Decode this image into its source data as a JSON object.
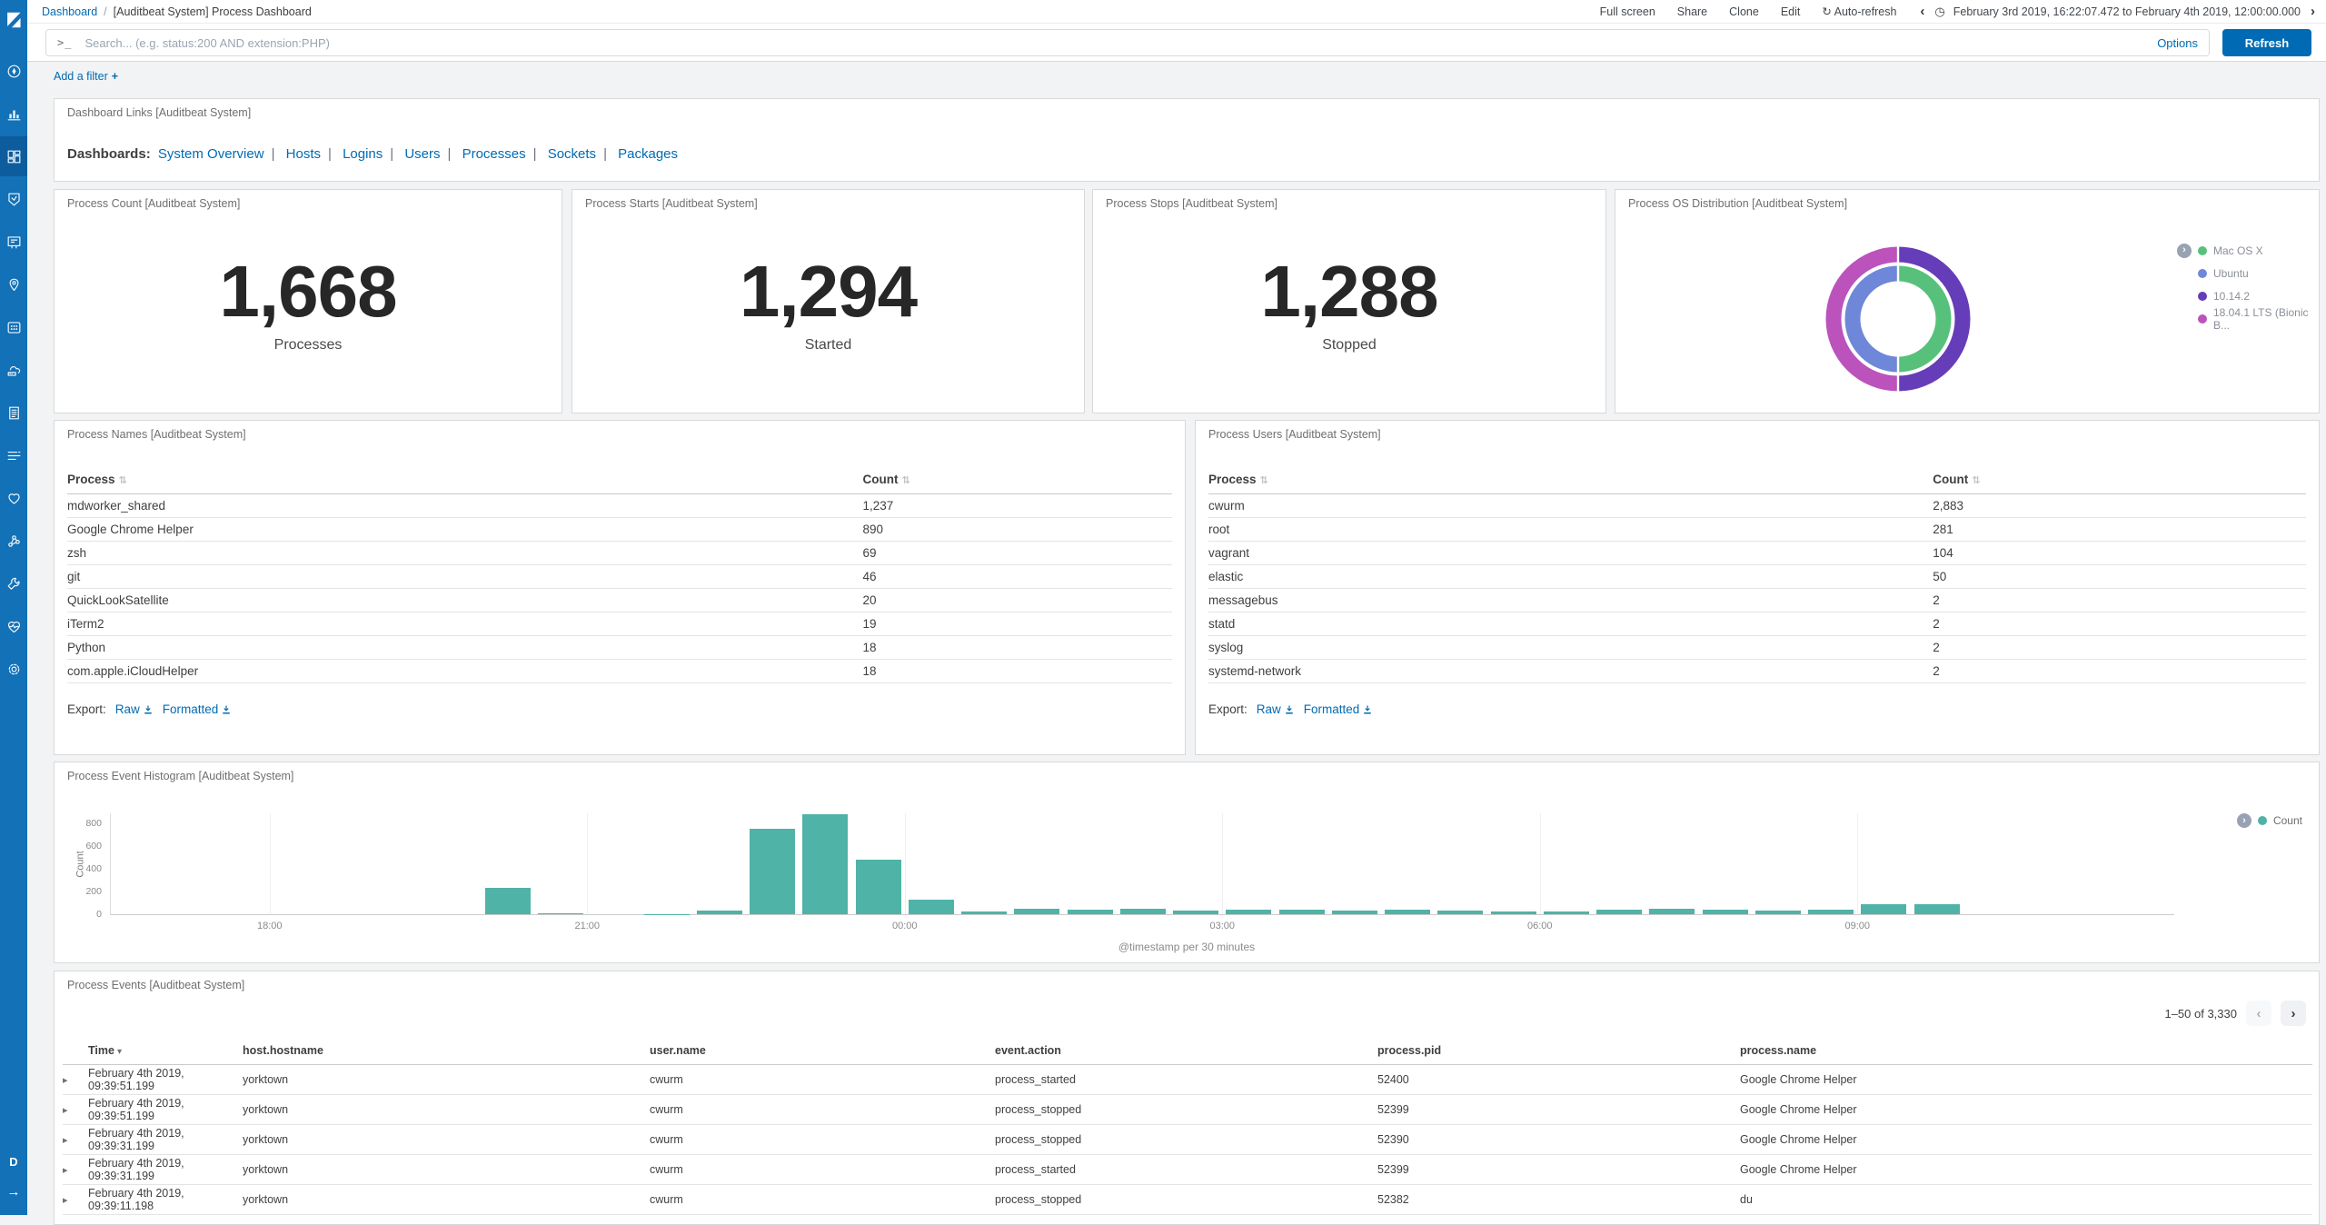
{
  "chrome": {
    "breadcrumb": {
      "root": "Dashboard",
      "separator": "/",
      "current": "[Auditbeat System] Process Dashboard"
    },
    "menu": {
      "full_screen": "Full screen",
      "share": "Share",
      "clone": "Clone",
      "edit": "Edit",
      "auto_refresh": "Auto-refresh"
    },
    "time_picker": {
      "prev": "‹",
      "range": "February 3rd 2019, 16:22:07.472 to February 4th 2019, 12:00:00.000",
      "next": "›"
    },
    "search": {
      "placeholder": "Search... (e.g. status:200 AND extension:PHP)",
      "options_label": "Options",
      "refresh_label": "Refresh"
    },
    "filter_bar": {
      "add_filter_label": "Add a filter",
      "plus": "+"
    }
  },
  "icons": {
    "prompt": ">_",
    "clock": "◷",
    "refresh_cycle": "↻",
    "sort": "⇅",
    "caret_down": "▾",
    "row_expand": "▸",
    "legend_toggle": "›",
    "collapse_arrow": "→"
  },
  "sidebar": {
    "space_badge": "D",
    "selected": "dashboard",
    "items": [
      "discover",
      "visualize",
      "dashboard",
      "timelion",
      "canvas",
      "maps",
      "machine-learning",
      "infrastructure",
      "logs",
      "apm",
      "uptime",
      "graph",
      "dev-tools",
      "monitoring",
      "management"
    ]
  },
  "colors": {
    "accent": "#006bb4",
    "sidebar": "#1271b7",
    "sidebar_selected": "#0d5d9e",
    "space_badge": "#00bfb3",
    "histogram_bar": "#4fb3a7"
  },
  "links_panel": {
    "title": "Dashboard Links [Auditbeat System]",
    "prefix": "Dashboards:",
    "separator": "|",
    "links": [
      "System Overview",
      "Hosts",
      "Logins",
      "Users",
      "Processes",
      "Sockets",
      "Packages"
    ]
  },
  "metric_panels": [
    {
      "title": "Process Count [Auditbeat System]",
      "value": "1,668",
      "label": "Processes"
    },
    {
      "title": "Process Starts [Auditbeat System]",
      "value": "1,294",
      "label": "Started"
    },
    {
      "title": "Process Stops [Auditbeat System]",
      "value": "1,288",
      "label": "Stopped"
    }
  ],
  "os_panel": {
    "title": "Process OS Distribution [Auditbeat System]",
    "legend": [
      {
        "label": "Mac OS X",
        "color": "#57c17b"
      },
      {
        "label": "Ubuntu",
        "color": "#6f87d8"
      },
      {
        "label": "10.14.2",
        "color": "#663db8"
      },
      {
        "label": "18.04.1 LTS (Bionic B...",
        "color": "#bc52bc"
      }
    ]
  },
  "names_panel": {
    "title": "Process Names [Auditbeat System]",
    "columns": [
      "Process",
      "Count"
    ],
    "rows": [
      [
        "mdworker_shared",
        "1,237"
      ],
      [
        "Google Chrome Helper",
        "890"
      ],
      [
        "zsh",
        "69"
      ],
      [
        "git",
        "46"
      ],
      [
        "QuickLookSatellite",
        "20"
      ],
      [
        "iTerm2",
        "19"
      ],
      [
        "Python",
        "18"
      ],
      [
        "com.apple.iCloudHelper",
        "18"
      ]
    ],
    "export_label": "Export:",
    "export_raw": "Raw",
    "export_formatted": "Formatted"
  },
  "users_panel": {
    "title": "Process Users [Auditbeat System]",
    "columns": [
      "Process",
      "Count"
    ],
    "rows": [
      [
        "cwurm",
        "2,883"
      ],
      [
        "root",
        "281"
      ],
      [
        "vagrant",
        "104"
      ],
      [
        "elastic",
        "50"
      ],
      [
        "messagebus",
        "2"
      ],
      [
        "statd",
        "2"
      ],
      [
        "syslog",
        "2"
      ],
      [
        "systemd-network",
        "2"
      ]
    ],
    "export_label": "Export:",
    "export_raw": "Raw",
    "export_formatted": "Formatted"
  },
  "histogram_panel": {
    "title": "Process Event Histogram [Auditbeat System]"
  },
  "events_panel": {
    "title": "Process Events [Auditbeat System]",
    "pagination": "1–50 of 3,330",
    "prev": "‹",
    "next": "›",
    "columns": [
      "Time",
      "host.hostname",
      "user.name",
      "event.action",
      "process.pid",
      "process.name"
    ],
    "rows": [
      [
        "February 4th 2019, 09:39:51.199",
        "yorktown",
        "cwurm",
        "process_started",
        "52400",
        "Google Chrome Helper"
      ],
      [
        "February 4th 2019, 09:39:51.199",
        "yorktown",
        "cwurm",
        "process_stopped",
        "52399",
        "Google Chrome Helper"
      ],
      [
        "February 4th 2019, 09:39:31.199",
        "yorktown",
        "cwurm",
        "process_stopped",
        "52390",
        "Google Chrome Helper"
      ],
      [
        "February 4th 2019, 09:39:31.199",
        "yorktown",
        "cwurm",
        "process_started",
        "52399",
        "Google Chrome Helper"
      ],
      [
        "February 4th 2019, 09:39:11.198",
        "yorktown",
        "cwurm",
        "process_stopped",
        "52382",
        "du"
      ]
    ]
  },
  "chart_data": [
    {
      "type": "bar",
      "title": "Process Event Histogram [Auditbeat System]",
      "xlabel": "@timestamp per 30 minutes",
      "ylabel": "Count",
      "ylim": [
        0,
        900
      ],
      "yticks": [
        0,
        200,
        400,
        600,
        800
      ],
      "x_axis_hours": [
        16.5,
        36
      ],
      "bucket_minutes": 30,
      "grid": "vertical-faint",
      "legend_position": "top-right",
      "xticks": [
        {
          "hour": 18,
          "label": "18:00"
        },
        {
          "hour": 21,
          "label": "21:00"
        },
        {
          "hour": 24,
          "label": "00:00"
        },
        {
          "hour": 27,
          "label": "03:00"
        },
        {
          "hour": 30,
          "label": "06:00"
        },
        {
          "hour": 33,
          "label": "09:00"
        }
      ],
      "series": [
        {
          "name": "Count",
          "color": "#4fb3a7"
        }
      ],
      "bars": [
        [
          20,
          230
        ],
        [
          20.5,
          12
        ],
        [
          21.5,
          4
        ],
        [
          22,
          30
        ],
        [
          22.5,
          755
        ],
        [
          23,
          880
        ],
        [
          23.5,
          480
        ],
        [
          24,
          125
        ],
        [
          24.5,
          25
        ],
        [
          25,
          45
        ],
        [
          25.5,
          38
        ],
        [
          26,
          50
        ],
        [
          26.5,
          35
        ],
        [
          27,
          38
        ],
        [
          27.5,
          42
        ],
        [
          28,
          35
        ],
        [
          28.5,
          40
        ],
        [
          29,
          32
        ],
        [
          29.5,
          28
        ],
        [
          30,
          25
        ],
        [
          30.5,
          40
        ],
        [
          31,
          45
        ],
        [
          31.5,
          42
        ],
        [
          32,
          30
        ],
        [
          32.5,
          40
        ],
        [
          33,
          90
        ],
        [
          33.5,
          88
        ]
      ]
    },
    {
      "type": "pie",
      "subtype": "donut-two-ring",
      "title": "Process OS Distribution [Auditbeat System]",
      "legend_position": "right",
      "rings": [
        {
          "name": "os",
          "slices": [
            {
              "label": "Mac OS X",
              "value": 0.5,
              "color": "#57c17b"
            },
            {
              "label": "Ubuntu",
              "value": 0.5,
              "color": "#6f87d8"
            }
          ]
        },
        {
          "name": "os-version",
          "slices": [
            {
              "label": "10.14.2",
              "value": 0.5,
              "color": "#663db8"
            },
            {
              "label": "18.04.1 LTS (Bionic B...",
              "value": 0.5,
              "color": "#bc52bc"
            }
          ]
        }
      ]
    }
  ]
}
